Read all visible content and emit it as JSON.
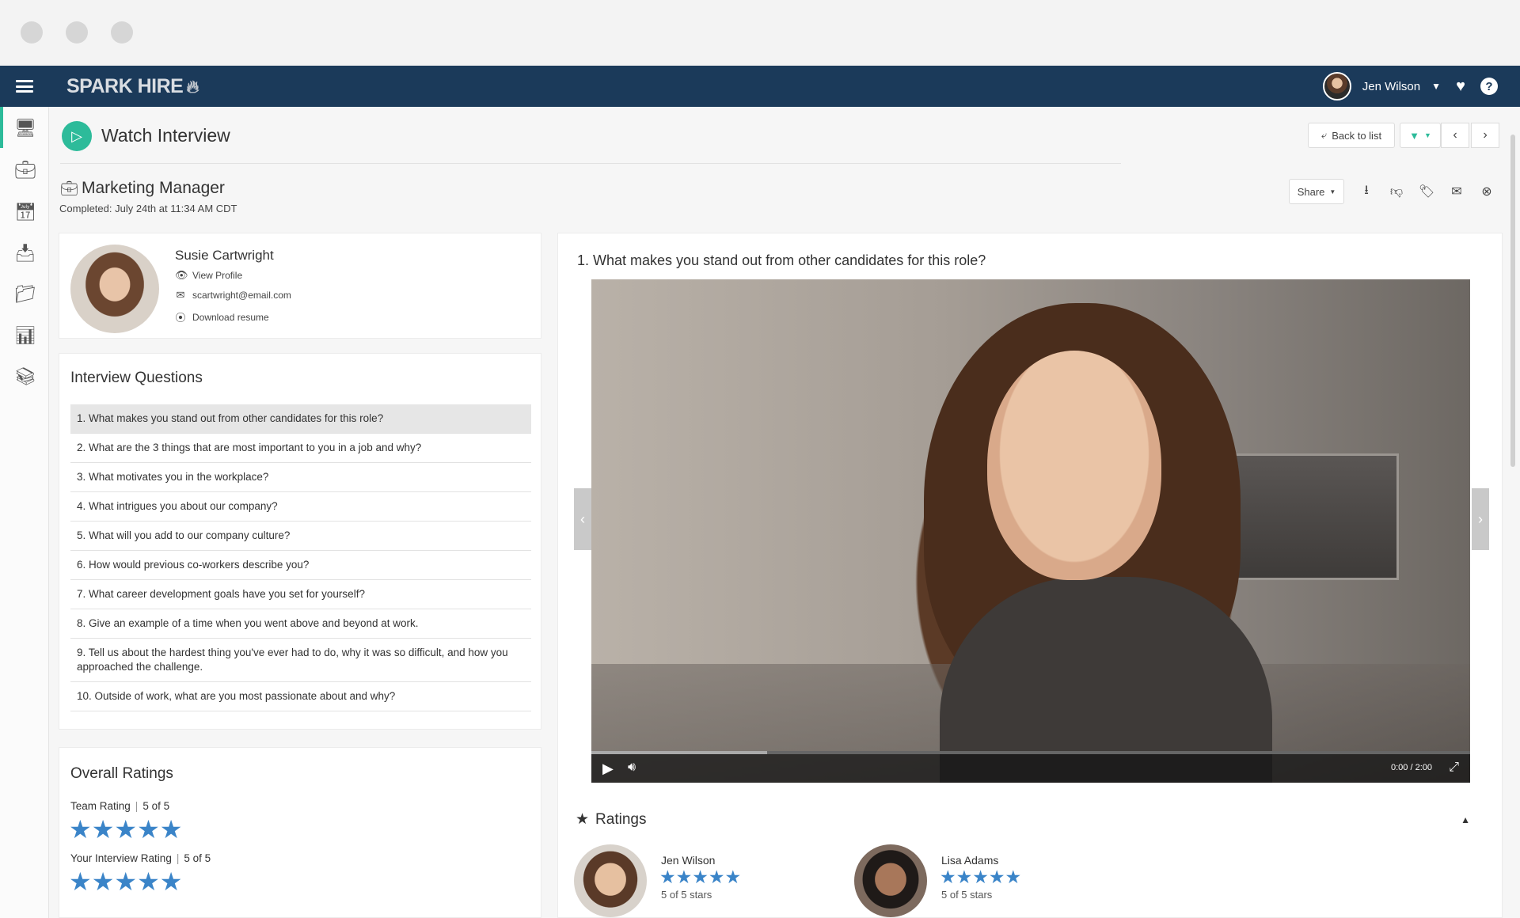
{
  "topbar": {
    "logo": "SPARK HIRE",
    "user_name": "Jen Wilson"
  },
  "header": {
    "title": "Watch Interview",
    "back_label": "Back to list",
    "share_label": "Share"
  },
  "job": {
    "title": "Marketing Manager",
    "completed": "Completed: July 24th at 11:34 AM CDT"
  },
  "candidate": {
    "name": "Susie Cartwright",
    "view_profile": "View Profile",
    "email": "scartwright@email.com",
    "download_resume": "Download resume"
  },
  "questions": {
    "heading": "Interview Questions",
    "items": [
      "1. What makes you stand out from other candidates for this role?",
      "2. What are the 3 things that are most important to you in a job and why?",
      "3. What motivates you in the workplace?",
      "4. What intrigues you about our company?",
      "5. What will you add to our company culture?",
      "6. How would previous co-workers describe you?",
      "7. What career development goals have you set for yourself?",
      "8. Give an example of a time when you went above and beyond at work.",
      "9. Tell us about the hardest thing you've ever had to do, why it was so difficult, and how you approached the challenge.",
      "10. Outside of work, what are you most passionate about and why?"
    ]
  },
  "overall": {
    "heading": "Overall Ratings",
    "team_label": "Team Rating",
    "team_value": "5 of 5",
    "your_label": "Your Interview Rating",
    "your_value": "5 of 5",
    "stars": "★★★★★"
  },
  "video": {
    "question": "1. What makes you stand out from other candidates for this role?",
    "time": "0:00  /  2:00",
    "progress": 0.2
  },
  "ratings": {
    "title": "Ratings",
    "raters": [
      {
        "name": "Jen Wilson",
        "stars": "★★★★★",
        "summary": "5 of 5 stars"
      },
      {
        "name": "Lisa Adams",
        "stars": "★★★★★",
        "summary": "5 of 5 stars"
      }
    ]
  },
  "colors": {
    "nav": "#1b3a5a",
    "accent": "#2dbb9a",
    "star": "#3a84c8"
  }
}
